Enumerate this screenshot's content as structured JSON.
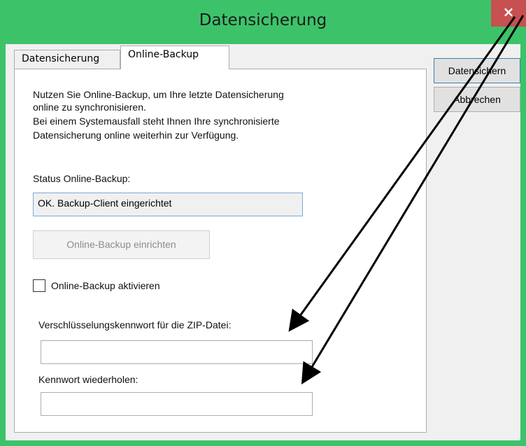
{
  "window": {
    "title": "Datensicherung",
    "close_symbol": "×"
  },
  "tabs": [
    {
      "label": "Datensicherung",
      "active": false
    },
    {
      "label": "Online-Backup",
      "active": true
    }
  ],
  "panel": {
    "description_lines": [
      "Nutzen Sie Online-Backup, um Ihre letzte Datensicherung",
      "online zu synchronisieren.",
      "Bei einem Systemausfall steht Ihnen Ihre synchronisierte",
      "Datensicherung online weiterhin zur Verfügung."
    ],
    "status_label": "Status Online-Backup:",
    "status_value": "OK. Backup-Client eingerichtet",
    "setup_button_label": "Online-Backup einrichten",
    "checkbox_label": "Online-Backup aktivieren",
    "checkbox_checked": false,
    "password_label": "Verschlüsselungskennwort für die ZIP-Datei:",
    "password_value": "",
    "repeat_label": "Kennwort wiederholen:",
    "repeat_value": ""
  },
  "side_buttons": {
    "save_label": "Datensichern",
    "cancel_label": "Abbrechen"
  },
  "colors": {
    "titlebar": "#3cc36a",
    "close_button": "#c75050",
    "annotation_arrows": "#000000"
  }
}
